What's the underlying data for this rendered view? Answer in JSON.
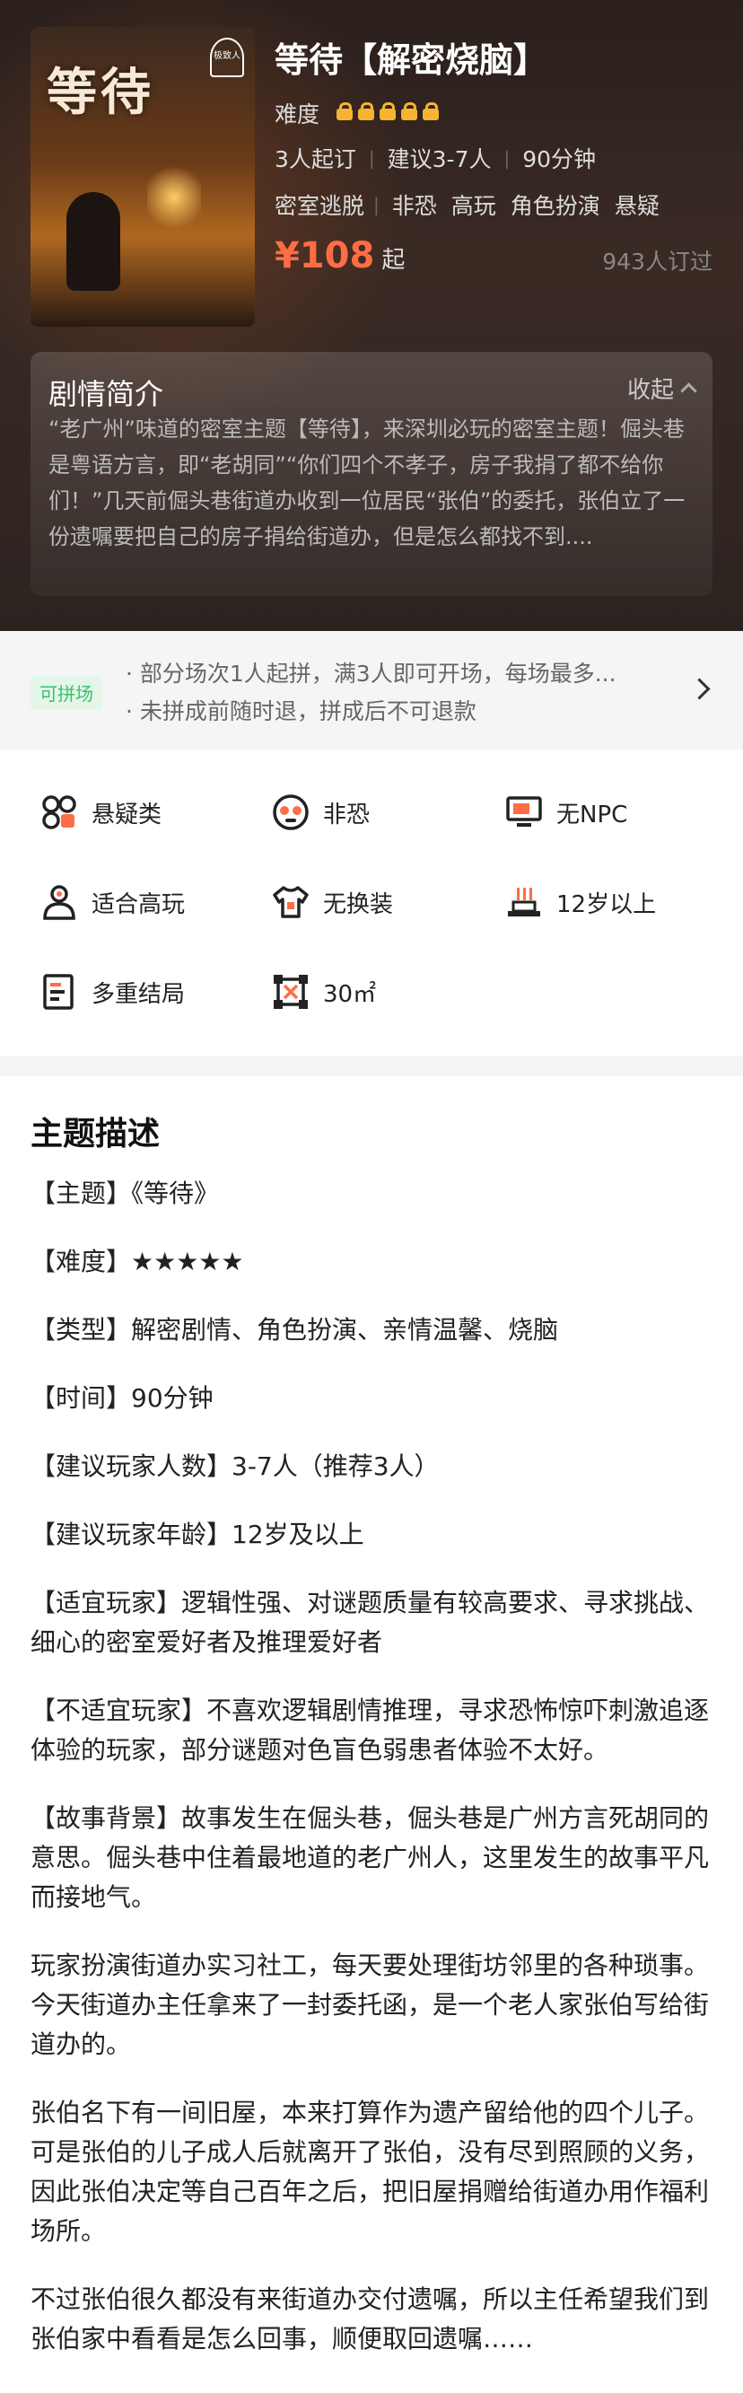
{
  "header": {
    "title": "等待【解密烧脑】",
    "difficulty_label": "难度",
    "difficulty_level": 5,
    "meta": [
      "3人起订",
      "建议3-7人",
      "90分钟"
    ],
    "tags": [
      "密室逃脱",
      "非恐",
      "高玩",
      "角色扮演",
      "悬疑"
    ],
    "price": "¥108",
    "price_suffix": "起",
    "booked": "943人订过",
    "poster_title": "等待",
    "poster_logo": "极致人"
  },
  "story": {
    "heading": "剧情简介",
    "toggle": "收起",
    "text": "“老广州”味道的密室主题【等待】，来深圳必玩的密室主题！倔头巷是粤语方言，即“老胡同”“你们四个不孝子，房子我捐了都不给你们！”几天前倔头巷街道办收到一位居民“张伯”的委托，张伯立了一份遗嘱要把自己的房子捐给街道办，但是怎么都找不到...."
  },
  "pin": {
    "badge": "可拼场",
    "line1": "· 部分场次1人起拼，满3人即可开场，每场最多...",
    "line2": "· 未拼成前随时退，拼成后不可退款"
  },
  "features": [
    {
      "label": "悬疑类",
      "icon": "puzzle-grid-icon"
    },
    {
      "label": "非恐",
      "icon": "face-icon"
    },
    {
      "label": "无NPC",
      "icon": "monitor-icon"
    },
    {
      "label": "适合高玩",
      "icon": "person-icon"
    },
    {
      "label": "无换装",
      "icon": "shirt-icon"
    },
    {
      "label": "12岁以上",
      "icon": "stairs-icon"
    },
    {
      "label": "多重结局",
      "icon": "document-icon"
    },
    {
      "label": "30㎡",
      "icon": "area-icon"
    }
  ],
  "accent_color": "#ff6d44",
  "description": {
    "heading": "主题描述",
    "paragraphs": [
      "【主题】《等待》",
      "【难度】★★★★★",
      "【类型】解密剧情、角色扮演、亲情温馨、烧脑",
      "【时间】90分钟",
      "【建议玩家人数】3-7人（推荐3人）",
      "【建议玩家年龄】12岁及以上",
      "【适宜玩家】逻辑性强、对谜题质量有较高要求、寻求挑战、细心的密室爱好者及推理爱好者",
      "【不适宜玩家】不喜欢逻辑剧情推理，寻求恐怖惊吓刺激追逐体验的玩家，部分谜题对色盲色弱患者体验不太好。",
      "【故事背景】故事发生在倔头巷，倔头巷是广州方言死胡同的意思。倔头巷中住着最地道的老广州人，这里发生的故事平凡而接地气。",
      "玩家扮演街道办实习社工，每天要处理街坊邻里的各种琐事。今天街道办主任拿来了一封委托函，是一个老人家张伯写给街道办的。",
      "张伯名下有一间旧屋，本来打算作为遗产留给他的四个儿子。可是张伯的儿子成人后就离开了张伯，没有尽到照顾的义务，因此张伯决定等自己百年之后，把旧屋捐赠给街道办用作福利场所。",
      "不过张伯很久都没有来街道办交付遗嘱，所以主任希望我们到张伯家中看看是怎么回事，顺便取回遗嘱……"
    ]
  }
}
